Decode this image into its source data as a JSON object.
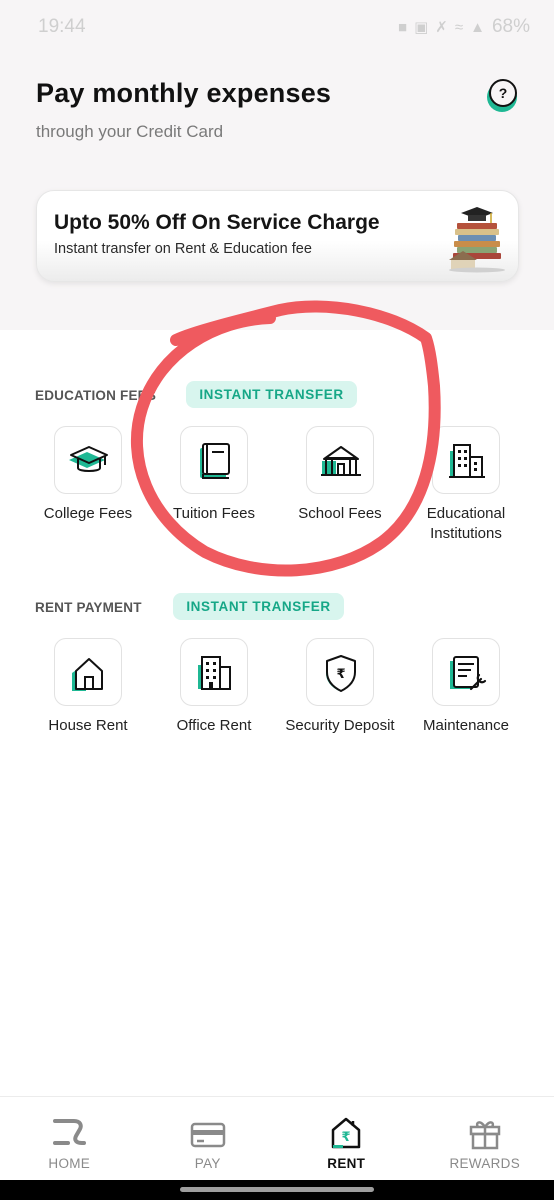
{
  "status_bar": {
    "time": "19:44",
    "battery": "68%"
  },
  "header": {
    "title": "Pay monthly expenses",
    "subtitle": "through your Credit Card",
    "help_glyph": "?"
  },
  "promo": {
    "title": "Upto 50% Off On Service Charge",
    "subtitle": "Instant transfer on Rent & Education fee",
    "illustration": "books-graduation-cap"
  },
  "education": {
    "label": "EDUCATION FEES",
    "badge": "INSTANT TRANSFER",
    "items": [
      {
        "label": "College Fees",
        "icon": "graduation-cap-icon"
      },
      {
        "label": "Tuition Fees",
        "icon": "book-icon"
      },
      {
        "label": "School Fees",
        "icon": "school-building-icon"
      },
      {
        "label": "Educational Institutions",
        "icon": "institution-building-icon"
      }
    ]
  },
  "rent": {
    "label": "RENT PAYMENT",
    "badge": "INSTANT TRANSFER",
    "items": [
      {
        "label": "House Rent",
        "icon": "house-icon"
      },
      {
        "label": "Office Rent",
        "icon": "office-building-icon"
      },
      {
        "label": "Security Deposit",
        "icon": "rupee-shield-icon"
      },
      {
        "label": "Maintenance",
        "icon": "maintenance-form-icon"
      }
    ]
  },
  "bottom_nav": {
    "items": [
      {
        "label": "HOME",
        "icon": "home-logo-icon",
        "active": false
      },
      {
        "label": "PAY",
        "icon": "card-icon",
        "active": false
      },
      {
        "label": "RENT",
        "icon": "rupee-house-icon",
        "active": true
      },
      {
        "label": "REWARDS",
        "icon": "gift-icon",
        "active": false
      }
    ]
  },
  "colors": {
    "accent": "#1fb894",
    "badge_bg": "#d8f5ee",
    "badge_text": "#16a787",
    "annotation": "#ef5a5f",
    "top_bg": "#f7f5f6"
  }
}
